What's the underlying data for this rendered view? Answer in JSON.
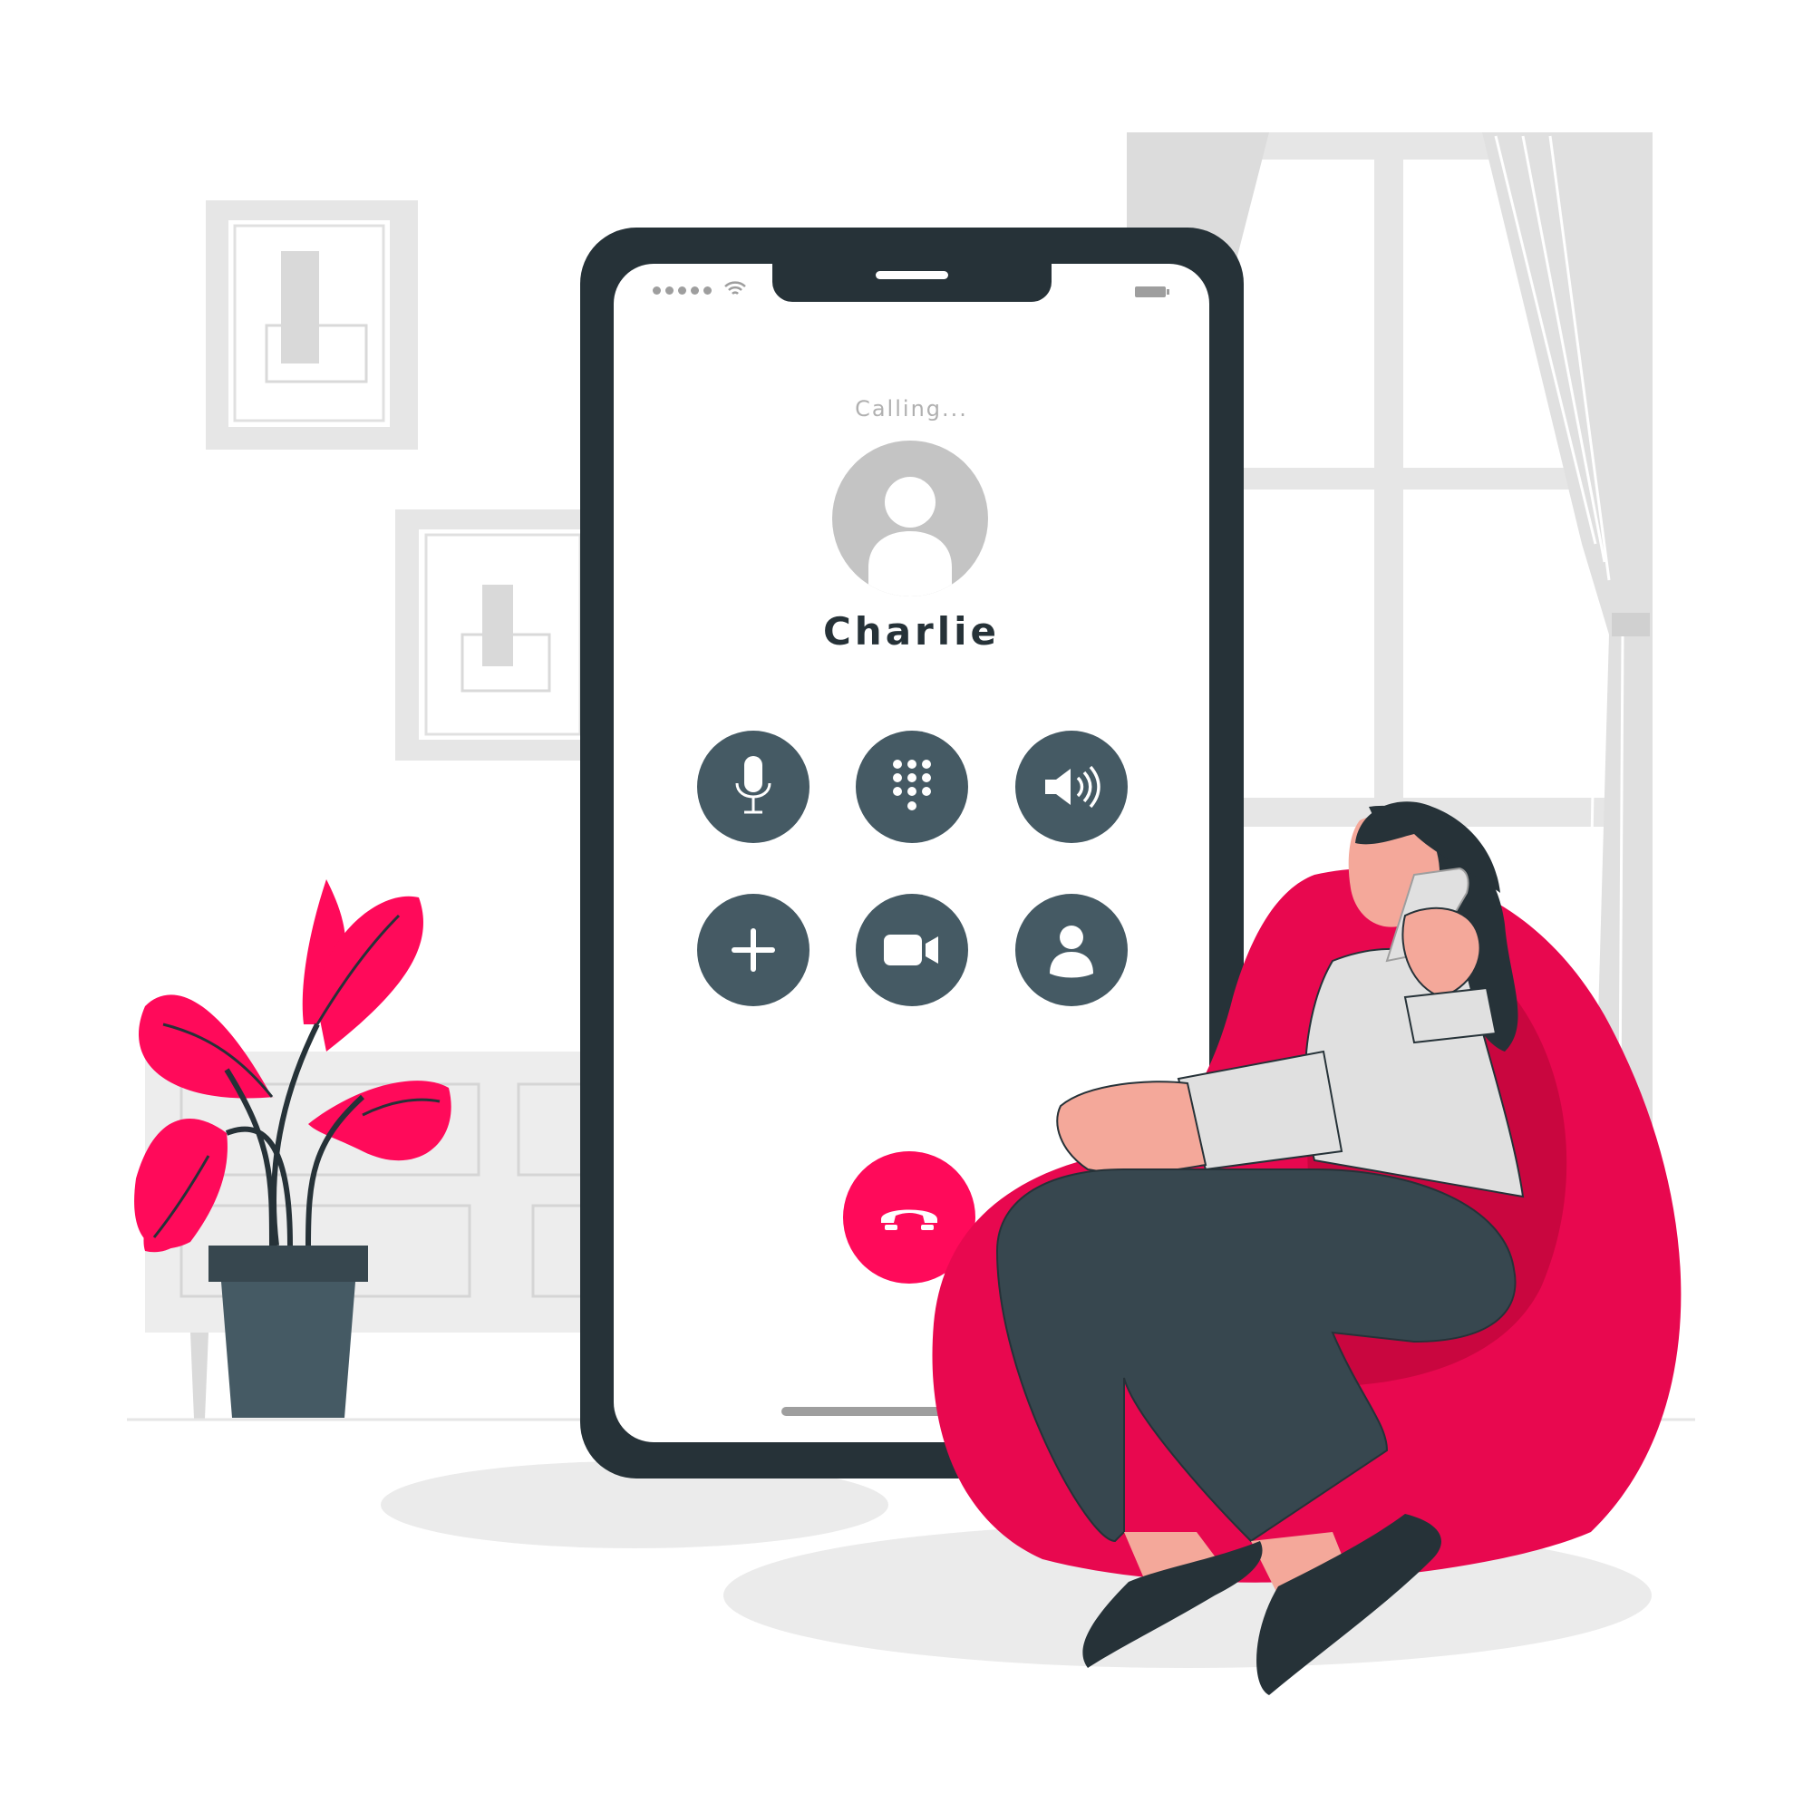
{
  "call_screen": {
    "status_text": "Calling...",
    "contact_name": "Charlie"
  },
  "controls": [
    {
      "name": "mute",
      "icon": "microphone-icon"
    },
    {
      "name": "keypad",
      "icon": "keypad-icon"
    },
    {
      "name": "speaker",
      "icon": "speaker-icon"
    },
    {
      "name": "add-call",
      "icon": "plus-icon"
    },
    {
      "name": "video",
      "icon": "video-camera-icon"
    },
    {
      "name": "contacts",
      "icon": "person-icon"
    }
  ],
  "end_call": {
    "icon": "phone-hangup-icon"
  },
  "status_bar": {
    "icons": [
      "signal-dots-icon",
      "wifi-icon",
      "battery-icon"
    ]
  },
  "colors": {
    "accent": "#ff0a5a",
    "button": "#455a64",
    "phone_frame": "#263238",
    "muted_text": "#b0b0b0",
    "bean_bag": "#e8084f"
  }
}
